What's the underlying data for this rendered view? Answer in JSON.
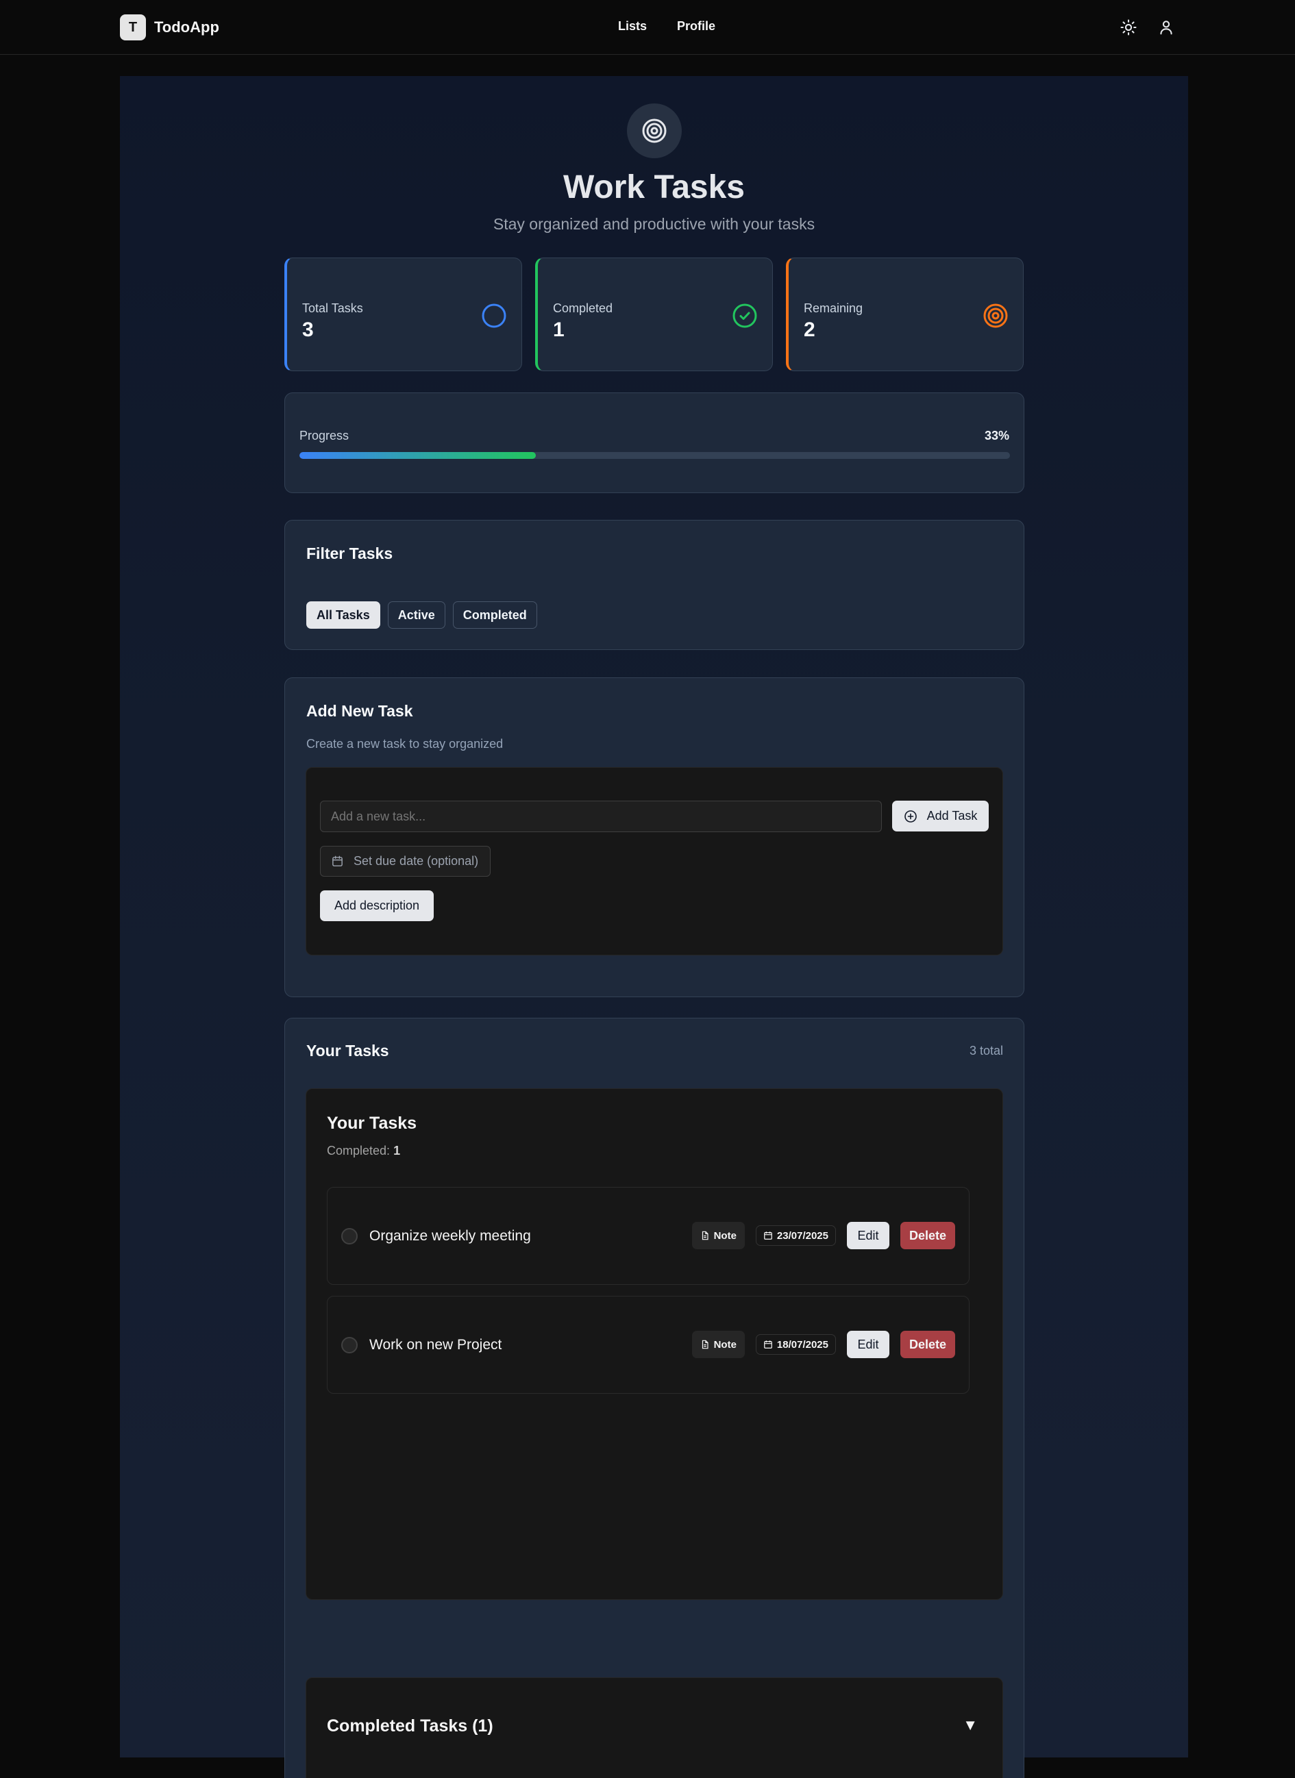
{
  "nav": {
    "logo_letter": "T",
    "brand": "TodoApp",
    "links": [
      "Lists",
      "Profile"
    ],
    "theme_icon": "sun-icon",
    "user_icon": "user-icon"
  },
  "header": {
    "icon": "target-icon",
    "title": "Work Tasks",
    "subtitle": "Stay organized and productive with your tasks"
  },
  "stats": [
    {
      "label": "Total Tasks",
      "value": "3",
      "icon": "circle-icon",
      "color": "#3b82f6"
    },
    {
      "label": "Completed",
      "value": "1",
      "icon": "check-circle-icon",
      "color": "#22c55e"
    },
    {
      "label": "Remaining",
      "value": "2",
      "icon": "target-icon",
      "color": "#f97316"
    }
  ],
  "progress": {
    "label": "Progress",
    "percent_label": "33%",
    "fraction": 0.333
  },
  "filter": {
    "title": "Filter Tasks",
    "buttons": [
      "All Tasks",
      "Active",
      "Completed"
    ],
    "active": "All Tasks"
  },
  "add_task": {
    "title": "Add New Task",
    "subtitle": "Create a new task to stay organized",
    "input_placeholder": "Add a new task...",
    "add_button": "Add Task",
    "due_placeholder": "Set due date (optional)",
    "description_button": "Add description"
  },
  "tasks": {
    "title": "Your Tasks",
    "total_label": "3 total",
    "inner_title": "Your Tasks",
    "completed_prefix": "Completed: ",
    "completed_count": "1",
    "items": [
      {
        "title": "Organize weekly meeting",
        "note_label": "Note",
        "date": "23/07/2025",
        "edit_label": "Edit",
        "delete_label": "Delete"
      },
      {
        "title": "Work on new Project",
        "note_label": "Note",
        "date": "18/07/2025",
        "edit_label": "Edit",
        "delete_label": "Delete"
      }
    ],
    "completed_section_title": "Completed Tasks (1)",
    "completed_section_chevron": "▼"
  },
  "colors": {
    "accent_blue": "#3b82f6",
    "accent_green": "#22c55e",
    "accent_orange": "#f97316",
    "danger": "#a83f44"
  }
}
